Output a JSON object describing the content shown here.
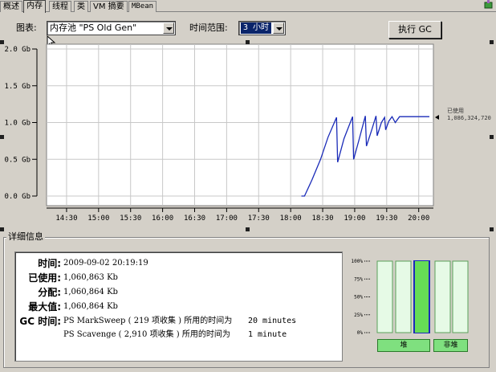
{
  "tabs": [
    {
      "label": "概述",
      "active": false
    },
    {
      "label": "内存",
      "active": true
    },
    {
      "label": "线程",
      "active": false
    },
    {
      "label": "类",
      "active": false
    },
    {
      "label": "VM 摘要",
      "active": false
    },
    {
      "label": "MBean",
      "active": false
    }
  ],
  "controls": {
    "chart_label": "图表:",
    "chart_value": "内存池 \"PS Old Gen\"",
    "range_label": "时间范围:",
    "range_value": "3 小时",
    "gc_button": "执行 GC"
  },
  "chart_data": {
    "type": "line",
    "y_ticks": [
      "2.0 Gb",
      "1.5 Gb",
      "1.0 Gb",
      "0.5 Gb",
      "0.0 Gb"
    ],
    "y_values": [
      2.0,
      1.5,
      1.0,
      0.5,
      0.0
    ],
    "x_ticks": [
      "14:30",
      "15:00",
      "15:30",
      "16:00",
      "16:30",
      "17:00",
      "17:30",
      "18:00",
      "18:30",
      "19:00",
      "19:30",
      "20:00"
    ],
    "x_start_min": 855,
    "x_end_min": 1210,
    "ylim": [
      0,
      2.0
    ],
    "series": [
      {
        "name": "已使用",
        "color": "#1a2bb8",
        "points": [
          [
            1090,
            0.0
          ],
          [
            1093,
            0.0
          ],
          [
            1100,
            0.22
          ],
          [
            1108,
            0.5
          ],
          [
            1115,
            0.8
          ],
          [
            1123,
            1.07
          ],
          [
            1124,
            0.46
          ],
          [
            1130,
            0.78
          ],
          [
            1138,
            1.08
          ],
          [
            1139,
            0.5
          ],
          [
            1144,
            0.76
          ],
          [
            1150,
            1.09
          ],
          [
            1151,
            0.68
          ],
          [
            1156,
            0.9
          ],
          [
            1160,
            1.09
          ],
          [
            1161,
            0.82
          ],
          [
            1165,
            1.0
          ],
          [
            1168,
            1.07
          ],
          [
            1169,
            0.9
          ],
          [
            1172,
            1.02
          ],
          [
            1175,
            1.08
          ],
          [
            1178,
            1.0
          ],
          [
            1182,
            1.08
          ],
          [
            1210,
            1.08
          ]
        ]
      }
    ],
    "annotation_label": "已使用",
    "annotation_value": "1,086,324,720"
  },
  "details": {
    "title": "详细信息",
    "rows": [
      {
        "label": "时间:",
        "value": "2009-09-02 20:19:19"
      },
      {
        "label": "已使用:",
        "value": "1,060,863 Kb"
      },
      {
        "label": "分配:",
        "value": "1,060,864 Kb"
      },
      {
        "label": "最大值:",
        "value": "1,060,864 Kb"
      }
    ],
    "gc_label": "GC 时间:",
    "gc_lines": [
      {
        "text": "PS MarkSweep ( 219 项收集 ) 所用的时间为",
        "duration": "20 minutes"
      },
      {
        "text": "PS Scavenge ( 2,910 项收集 ) 所用的时间为",
        "duration": "1 minute"
      }
    ]
  },
  "pools": {
    "y_ticks": [
      "100%",
      "75%",
      "50%",
      "25%",
      "0%"
    ],
    "bars": [
      {
        "fill": 0.0,
        "selected": false
      },
      {
        "fill": 0.0,
        "selected": false
      },
      {
        "fill": 1.0,
        "selected": true
      },
      {
        "fill": 0.0,
        "selected": false
      },
      {
        "fill": 0.0,
        "selected": false
      }
    ],
    "heap_label": "堆",
    "nonheap_label": "非堆"
  }
}
